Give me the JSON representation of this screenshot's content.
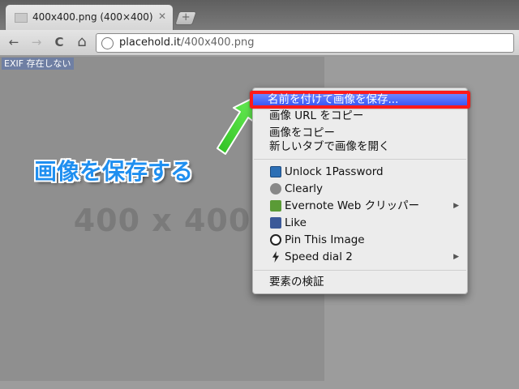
{
  "tab": {
    "title": "400x400.png (400×400)",
    "close_glyph": "✕",
    "new_tab_glyph": "+"
  },
  "toolbar": {
    "back_glyph": "←",
    "forward_glyph": "→",
    "reload_glyph": "C",
    "home_glyph": "⌂",
    "url_host": "placehold.it",
    "url_path": "/400x400.png"
  },
  "page": {
    "exif_badge": "EXIF 存在しない",
    "placeholder_text": "400 x 400",
    "callout": "画像を保存する"
  },
  "context_menu": {
    "items": [
      {
        "label": "名前を付けて画像を保存...",
        "highlighted": true
      },
      {
        "label": "画像 URL をコピー"
      },
      {
        "label": "画像をコピー"
      },
      {
        "label": "新しいタブで画像を開く"
      },
      {
        "label": "Unlock 1Password",
        "icon": "onepassword-icon"
      },
      {
        "label": "Clearly",
        "icon": "clearly-icon"
      },
      {
        "label": "Evernote Web クリッパー",
        "icon": "evernote-icon",
        "submenu": true
      },
      {
        "label": "Like",
        "icon": "facebook-icon"
      },
      {
        "label": "Pin This Image",
        "icon": "pinterest-icon"
      },
      {
        "label": "Speed dial 2",
        "icon": "lightning-icon",
        "submenu": true
      },
      {
        "label": "要素の検証"
      }
    ],
    "submenu_glyph": "▶"
  },
  "colors": {
    "highlight_border": "#ff1a1a",
    "highlight_fill": "#3a57f5",
    "callout": "#1f8ff0",
    "arrow": "#39d62c"
  }
}
